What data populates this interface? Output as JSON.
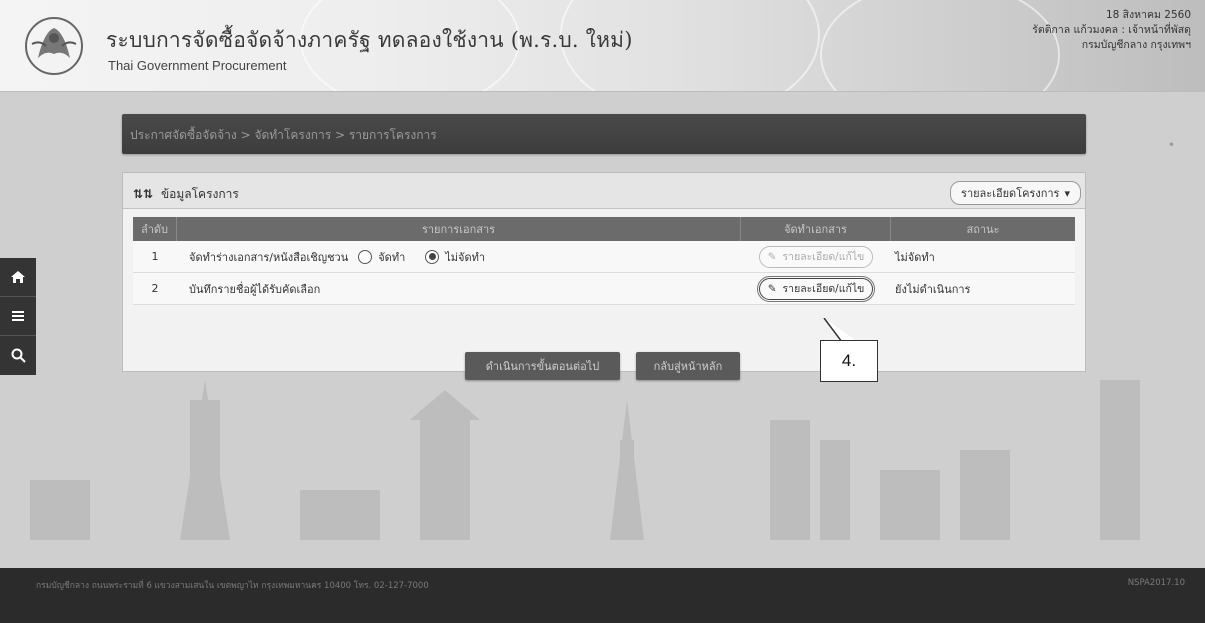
{
  "header": {
    "title": "ระบบการจัดซื้อจัดจ้างภาครัฐ ทดลองใช้งาน (พ.ร.บ. ใหม่)",
    "subtitle": "Thai Government Procurement",
    "date": "18 สิงหาคม 2560",
    "user": "รัตติกาล แก้วมงคล : เจ้าหน้าที่พัสดุ",
    "department": "กรมบัญชีกลาง กรุงเทพฯ"
  },
  "nav": {
    "icons": [
      "home-icon",
      "menu-icon",
      "search-icon"
    ]
  },
  "breadcrumb": {
    "text": "ประกาศจัดซื้อจัดจ้าง > จัดทำโครงการ > รายการโครงการ"
  },
  "panel": {
    "title": "ข้อมูลโครงการ",
    "dropdown_label": "รายละเอียดโครงการ"
  },
  "table": {
    "headers": {
      "no": "ลำดับ",
      "list": "รายการเอกสาร",
      "manage": "จัดทำเอกสาร",
      "status": "สถานะ"
    },
    "rows": [
      {
        "no": "1",
        "label": "จัดทำร่างเอกสาร/หนังสือเชิญชวน",
        "option_yes": "จัดทำ",
        "option_no": "ไม่จัดทำ",
        "selected": "ไม่จัดทำ",
        "button": "รายละเอียด/แก้ไข",
        "status": "ไม่จัดทำ"
      },
      {
        "no": "2",
        "label": "บันทึกรายชื่อผู้ได้รับคัดเลือก",
        "button": "รายละเอียด/แก้ไข",
        "status": "ยังไม่ดำเนินการ"
      }
    ]
  },
  "actions": {
    "next_label": "ดำเนินการขั้นตอนต่อไป",
    "home_label": "กลับสู่หน้าหลัก"
  },
  "callout": {
    "label": "4."
  },
  "footer": {
    "text": "กรมบัญชีกลาง ถนนพระรามที่ 6 แขวงสามเสนใน เขตพญาไท กรุงเทพมหานคร 10400 โทร. 02-127-7000",
    "version": "NSPA2017.10"
  }
}
